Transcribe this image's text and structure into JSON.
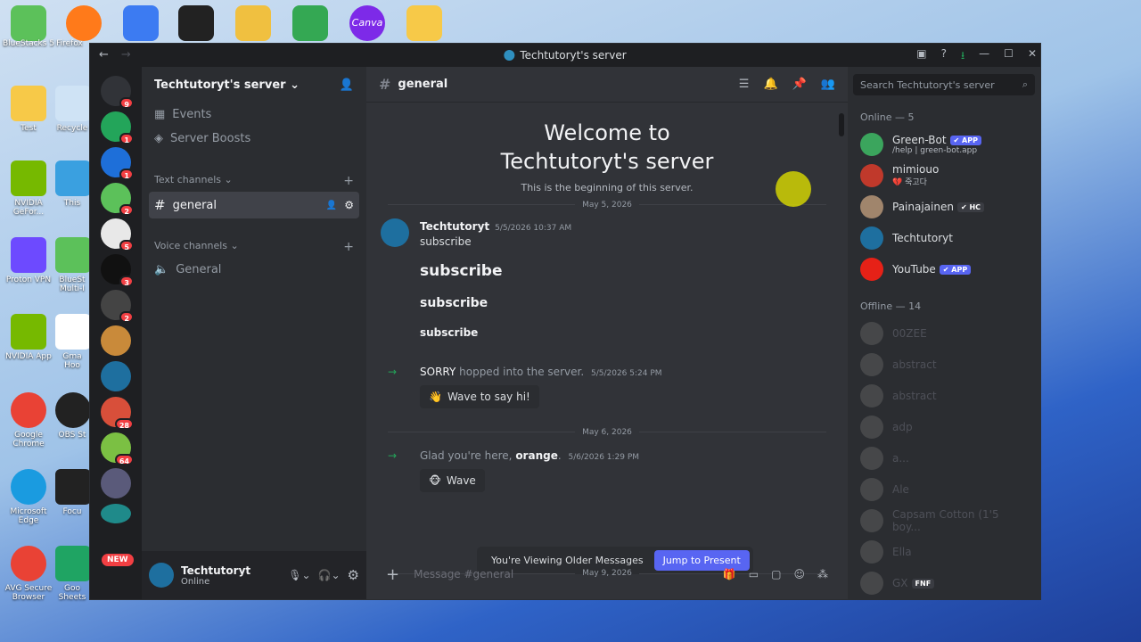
{
  "desktop": {
    "icons": [
      "BlueStacks 5",
      "Firefox",
      "Test",
      "Recycle",
      "NVIDIA GeFor...",
      "This",
      "Proton VPN",
      "BlueSt Multi-I",
      "NVIDIA App",
      "Gma Hoo",
      "Google Chrome",
      "OBS St",
      "Microsoft Edge",
      "Focu",
      "AVG Secure Browser",
      "Goo Sheets"
    ],
    "canva_label": "Canva"
  },
  "window": {
    "title": "Techtutoryt's server"
  },
  "guilds": {
    "badges": [
      "9",
      "1",
      "1",
      "2",
      "5",
      "3",
      "2",
      "28",
      "64"
    ],
    "new_label": "NEW"
  },
  "sidebar": {
    "server_name": "Techtutoryt's server",
    "events": "Events",
    "boosts": "Server Boosts",
    "text_category": "Text channels",
    "text_channel": "general",
    "voice_category": "Voice channels",
    "voice_channel": "General"
  },
  "user": {
    "name": "Techtutoryt",
    "status": "Online"
  },
  "chat": {
    "channel": "general",
    "welcome_line1": "Welcome to",
    "welcome_line2": "Techtutoryt's server",
    "welcome_sub": "This is the beginning of this server.",
    "date1": "May 5, 2026",
    "author": "Techtutoryt",
    "time1": "5/5/2026 10:37 AM",
    "msg_text": "subscribe",
    "msg_h1": "subscribe",
    "msg_h2": "subscribe",
    "msg_h3": "subscribe",
    "join1_name": "SORRY",
    "join1_text": " hopped into the server.",
    "join1_time": "5/5/2026 5:24 PM",
    "wave_label": "Wave to say hi!",
    "date2": "May 6, 2026",
    "join2_prefix": "Glad you're here, ",
    "join2_name": "orange",
    "join2_suffix": ".",
    "join2_time": "5/6/2026 1:29 PM",
    "wave2_label": "Wave",
    "older_text": "You're Viewing Older Messages",
    "jump_label": "Jump to Present",
    "date3": "May 9, 2026",
    "placeholder": "Message #general"
  },
  "members": {
    "search_placeholder": "Search Techtutoryt's server",
    "online_header": "Online — 5",
    "online": [
      {
        "name": "Green-Bot",
        "sub": "/help | green-bot.app",
        "tag": "✔ APP",
        "color": "#3ba55d"
      },
      {
        "name": "mimiouo",
        "sub": "💔 죽고다",
        "tag": "",
        "color": "#c0392b"
      },
      {
        "name": "Painajainen",
        "sub": "",
        "tag": "✔ HC",
        "color": "#a0856c"
      },
      {
        "name": "Techtutoryt",
        "sub": "",
        "tag": "",
        "color": "#1e6f9f"
      },
      {
        "name": "YouTube",
        "sub": "",
        "tag": "✔ APP",
        "color": "#e62117"
      }
    ],
    "offline_header": "Offline — 14",
    "offline": [
      "00ZEE",
      "abstract",
      "abstract",
      "adp",
      "a...",
      "Ale",
      "Capsam Cotton (1'5 boy...",
      "Ella",
      "GX"
    ],
    "offline_tag": "FNF"
  }
}
